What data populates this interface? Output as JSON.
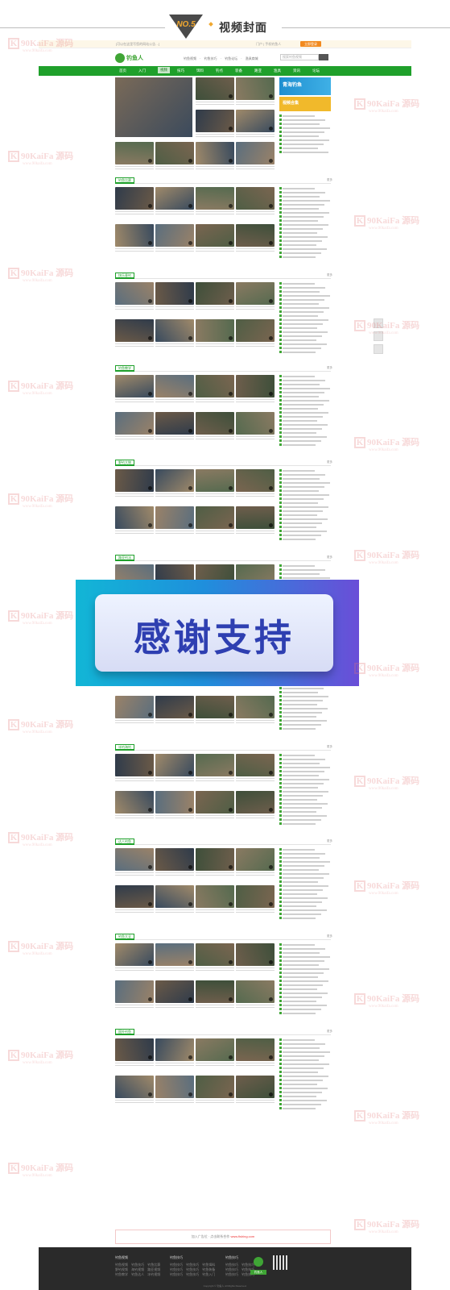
{
  "banner": {
    "badge": "NO.5",
    "title": "视频封面"
  },
  "site": {
    "topbar_text": "[可以在这里写您的网站公告…]",
    "topbar_right": "门户 | 手机钓鱼人",
    "topbar_cta": "立即登录",
    "logo_text": "钓鱼人",
    "header_links": "钓鱼视频 · 钓鱼技巧 · 钓鱼论坛 · 渔具商城",
    "search_placeholder": "搜索钓鱼视频",
    "nav": [
      "首页",
      "入门",
      "视频",
      "技巧",
      "饵料",
      "钓点",
      "装备",
      "路亚",
      "渔具",
      "资讯",
      "论坛"
    ],
    "promo1": "青海钓鱼",
    "promo2": "视频合集",
    "sections": [
      {
        "name": "钓鱼比赛",
        "more": "更多"
      },
      {
        "name": "快乐垂钓",
        "more": "更多"
      },
      {
        "name": "钓鱼教学",
        "more": "更多"
      },
      {
        "name": "野钓大物",
        "more": "更多"
      },
      {
        "name": "路亚钓法",
        "more": "更多"
      },
      {
        "name": "海钓视频",
        "more": "更多"
      },
      {
        "name": "冰钓海钓",
        "more": "更多"
      },
      {
        "name": "达人钓鱼",
        "more": "更多"
      },
      {
        "name": "钓鱼大全",
        "more": "更多"
      },
      {
        "name": "国外钓鱼",
        "more": "更多"
      }
    ],
    "overlay_text": "感谢支持",
    "footer_text": "加入广告位 · 点击联系合作",
    "footer_link": "www.fishing.com",
    "footer_cols": [
      {
        "head": "钓鱼视频",
        "rows": [
          "钓鱼视频 钓鱼技巧 钓鱼比赛",
          "野钓视频 海钓视频 路亚视频",
          "钓鱼教学 钓鱼达人 冰钓视频"
        ]
      },
      {
        "head": "钓鱼技巧",
        "rows": [
          "钓鱼技巧 钓鱼技巧 钓鱼饵料",
          "钓鱼技巧 钓鱼技巧 钓鱼装备",
          "钓鱼技巧 钓鱼技巧 钓鱼入门"
        ]
      },
      {
        "head": "钓鱼技巧",
        "rows": [
          "钓鱼技巧 钓鱼技巧",
          "钓鱼技巧 钓鱼技巧",
          "钓鱼技巧 钓鱼技巧"
        ]
      }
    ],
    "footer_app": "钓鱼人",
    "copyright": "Copyright © 钓鱼人 All Rights Reserved."
  },
  "watermark": {
    "brand": "90KaiFa 源码",
    "url": "www.90kaifa.com"
  }
}
